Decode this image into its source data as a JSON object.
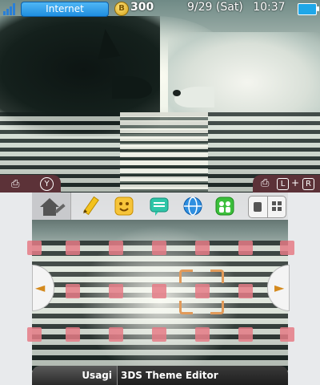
{
  "status_bar": {
    "connection_label": "Internet",
    "coin_symbol": "B",
    "coin_count": "300",
    "date": "9/29 (Sat)",
    "time": "10:37",
    "battery_icon": "battery-icon",
    "signal_icon": "signal-icon"
  },
  "top_controls": {
    "camera_icon": "camera-icon",
    "y_button": "Y",
    "screenshot_icon": "camera-icon",
    "l_key": "L",
    "plus": "+",
    "r_key": "R"
  },
  "toolbar": {
    "icons": [
      "home-settings-icon",
      "pencil-icon",
      "smiley-icon",
      "notes-icon",
      "globe-icon",
      "friends-icon"
    ],
    "view_toggle": [
      "single-view-icon",
      "grid-view-icon"
    ]
  },
  "navigation": {
    "left_arrow": "◄",
    "right_arrow": "►"
  },
  "bottom_bar": {
    "user_name": "Usagi",
    "theme_name": "3DS Theme Editor"
  },
  "colors": {
    "slot": "#e57b86",
    "accent": "#d48a1e",
    "internet": "#1f8ee0"
  }
}
